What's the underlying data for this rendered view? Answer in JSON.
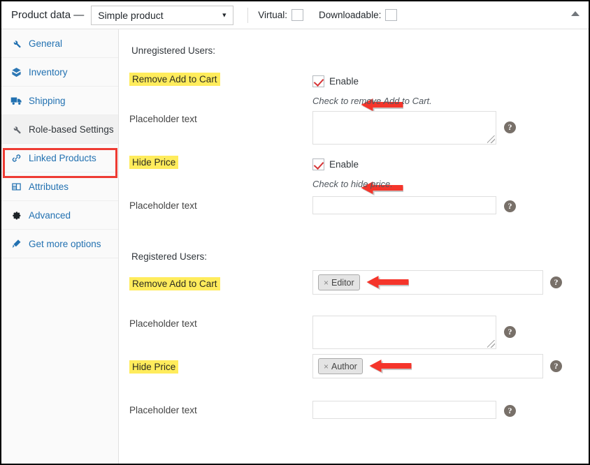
{
  "header": {
    "title": "Product data —",
    "product_type": {
      "selected": "Simple product",
      "caret": "chevron-down-icon"
    },
    "virtual": {
      "label": "Virtual:",
      "checked": false
    },
    "downloadable": {
      "label": "Downloadable:",
      "checked": false
    },
    "collapse_toggle": "collapse-panel-icon"
  },
  "sidebar": {
    "items": [
      {
        "label": "General",
        "icon": "wrench-icon",
        "active": false
      },
      {
        "label": "Inventory",
        "icon": "archive-icon",
        "active": false
      },
      {
        "label": "Shipping",
        "icon": "truck-icon",
        "active": false
      },
      {
        "label": "Role-based Settings",
        "icon": "wrench-icon",
        "active": true
      },
      {
        "label": "Linked Products",
        "icon": "link-icon",
        "active": false
      },
      {
        "label": "Attributes",
        "icon": "table-icon",
        "active": false
      },
      {
        "label": "Advanced",
        "icon": "gear-icon",
        "active": false
      },
      {
        "label": "Get more options",
        "icon": "plug-icon",
        "active": false
      }
    ]
  },
  "content": {
    "unregistered": {
      "heading": "Unregistered Users:",
      "remove_add_to_cart": {
        "label": "Remove Add to Cart",
        "highlighted": true,
        "enable_label": "Enable",
        "enable_checked": true,
        "description": "Check to remove Add to Cart.",
        "placeholder_label": "Placeholder text",
        "placeholder_value": "",
        "help": "?"
      },
      "hide_price": {
        "label": "Hide Price",
        "highlighted": true,
        "enable_label": "Enable",
        "enable_checked": true,
        "description": "Check to hide price.",
        "placeholder_label": "Placeholder text",
        "placeholder_value": "",
        "help": "?"
      }
    },
    "registered": {
      "heading": "Registered Users:",
      "remove_add_to_cart": {
        "label": "Remove Add to Cart",
        "highlighted": true,
        "role_token": "Editor",
        "token_remove": "×",
        "placeholder_label": "Placeholder text",
        "placeholder_value": "",
        "help": "?"
      },
      "hide_price": {
        "label": "Hide Price",
        "highlighted": true,
        "role_token": "Author",
        "token_remove": "×",
        "placeholder_label": "Placeholder text",
        "placeholder_value": "",
        "help": "?"
      }
    }
  },
  "annotations": {
    "arrow_color": "#f5352b",
    "box_color": "#ee3b33",
    "highlight_color": "#ffec5c"
  }
}
